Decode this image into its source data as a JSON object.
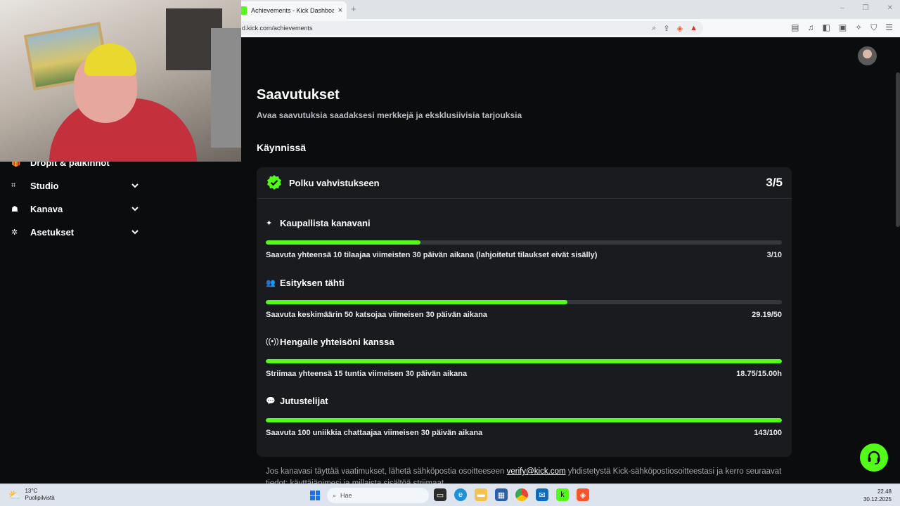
{
  "browser": {
    "tab_title": "Achievements - Kick Dashboard",
    "tab_close": "×",
    "new_tab": "+",
    "url": "d.kick.com/achievements"
  },
  "sidebar": {
    "items": [
      {
        "label": "Dropit & palkinnot",
        "icon": "gift-icon"
      },
      {
        "label": "Studio",
        "icon": "studio-icon"
      },
      {
        "label": "Kanava",
        "icon": "channel-icon"
      },
      {
        "label": "Asetukset",
        "icon": "gear-icon"
      }
    ]
  },
  "page": {
    "title": "Saavutukset",
    "subtitle": "Avaa saavutuksia saadaksesi merkkejä ja eksklusiivisia tarjouksia",
    "section_title": "Käynnissä"
  },
  "card": {
    "title": "Polku vahvistukseen",
    "progress": "3/5",
    "tasks": [
      {
        "name": "Kaupallista kanavani",
        "icon": "sparkle-icon",
        "description": "Saavuta yhteensä 10 tilaajaa viimeisten 30 päivän aikana (lahjoitetut tilaukset eivät sisälly)",
        "value": "3/10",
        "fill_fraction": 0.3
      },
      {
        "name": "Esityksen tähti",
        "icon": "viewers-icon",
        "description": "Saavuta keskimäärin 50 katsojaa viimeisen 30 päivän aikana",
        "value": "29.19/50",
        "fill_fraction": 0.5838
      },
      {
        "name": "Hengaile yhteisöni kanssa",
        "icon": "broadcast-icon",
        "description": "Striimaa yhteensä 15 tuntia viimeisen 30 päivän aikana",
        "value": "18.75/15.00h",
        "fill_fraction": 1.0
      },
      {
        "name": "Jutustelijat",
        "icon": "chat-icon",
        "description": "Saavuta 100 uniikkia chattaajaa viimeisen 30 päivän aikana",
        "value": "143/100",
        "fill_fraction": 1.0
      }
    ]
  },
  "footer": {
    "text_before": "Jos kanavasi täyttää vaatimukset, lähetä sähköpostia osoitteeseen ",
    "email": "verify@kick.com",
    "text_after": " yhdistetystä Kick-sähköpostiosoitteestasi ja kerro seuraavat tiedot: käyttäjänimesi ja millaista sisältöä striimaat."
  },
  "taskbar": {
    "weather_temp": "13°C",
    "weather_desc": "Puolipilvistä",
    "search_placeholder": "Hae",
    "time": "22.48",
    "date": "30.12.2025"
  },
  "colors": {
    "accent": "#53fc18",
    "card_bg": "#191b1f",
    "page_bg": "#0b0c0d",
    "bar_track": "#34373c"
  }
}
